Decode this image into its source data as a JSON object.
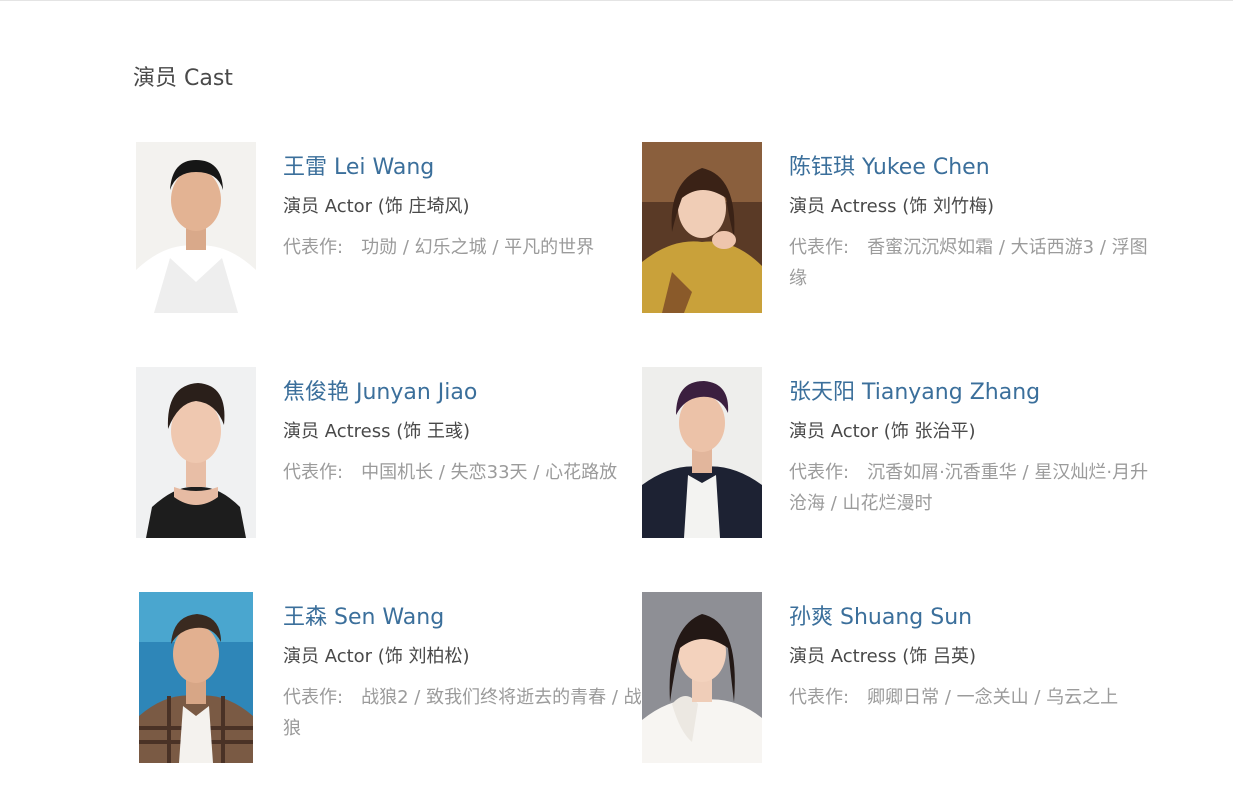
{
  "section": {
    "title": "演员 Cast"
  },
  "cast": [
    {
      "name": "王雷 Lei Wang",
      "role": "演员 Actor (饰 庄埼风)",
      "works_label": "代表作:",
      "works": [
        "功勋",
        "幻乐之城",
        "平凡的世界"
      ]
    },
    {
      "name": "陈钰琪 Yukee Chen",
      "role": "演员 Actress (饰 刘竹梅)",
      "works_label": "代表作:",
      "works": [
        "香蜜沉沉烬如霜",
        "大话西游3",
        "浮图缘"
      ]
    },
    {
      "name": "焦俊艳 Junyan Jiao",
      "role": "演员 Actress (饰 王彧)",
      "works_label": "代表作:",
      "works": [
        "中国机长",
        "失恋33天",
        "心花路放"
      ]
    },
    {
      "name": "张天阳 Tianyang Zhang",
      "role": "演员 Actor (饰 张治平)",
      "works_label": "代表作:",
      "works": [
        "沉香如屑·沉香重华",
        "星汉灿烂·月升沧海",
        "山花烂漫时"
      ]
    },
    {
      "name": "王森 Sen Wang",
      "role": "演员 Actor (饰 刘柏松)",
      "works_label": "代表作:",
      "works": [
        "战狼2",
        "致我们终将逝去的青春",
        "战狼"
      ]
    },
    {
      "name": "孙爽 Shuang Sun",
      "role": "演员 Actress (饰 吕英)",
      "works_label": "代表作:",
      "works": [
        "卿卿日常",
        "一念关山",
        "乌云之上"
      ]
    }
  ],
  "colors": {
    "name_link": "#3b6f9b",
    "role_text": "#494949",
    "works_text": "#9b9b9b"
  }
}
